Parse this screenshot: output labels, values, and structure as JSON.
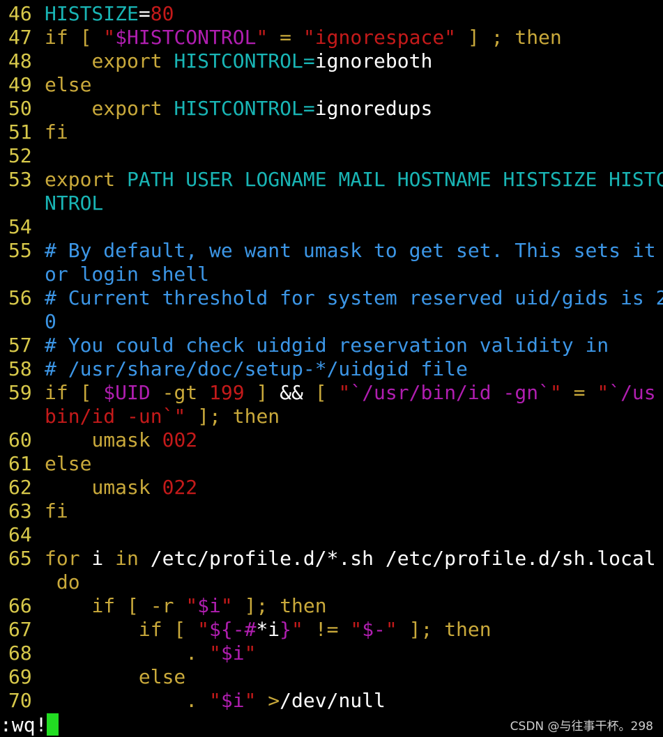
{
  "editor": {
    "rows": [
      {
        "num": "46",
        "segs": [
          [
            "HISTSIZE",
            "var"
          ],
          [
            "=",
            "txt"
          ],
          [
            "80",
            "str"
          ]
        ]
      },
      {
        "num": "47",
        "segs": [
          [
            "if",
            "kw"
          ],
          [
            " [ ",
            "op"
          ],
          [
            "\"",
            "str"
          ],
          [
            "$HISTCONTROL",
            "env"
          ],
          [
            "\"",
            "str"
          ],
          [
            " = ",
            "op"
          ],
          [
            "\"ignorespace\"",
            "str"
          ],
          [
            " ] ; ",
            "op"
          ],
          [
            "then",
            "kw"
          ]
        ]
      },
      {
        "num": "48",
        "segs": [
          [
            "    ",
            "txt"
          ],
          [
            "export",
            "kw"
          ],
          [
            " ",
            "txt"
          ],
          [
            "HISTCONTROL=",
            "var"
          ],
          [
            "ignoreboth",
            "txt"
          ]
        ]
      },
      {
        "num": "49",
        "segs": [
          [
            "else",
            "kw"
          ]
        ]
      },
      {
        "num": "50",
        "segs": [
          [
            "    ",
            "txt"
          ],
          [
            "export",
            "kw"
          ],
          [
            " ",
            "txt"
          ],
          [
            "HISTCONTROL=",
            "var"
          ],
          [
            "ignoredups",
            "txt"
          ]
        ]
      },
      {
        "num": "51",
        "segs": [
          [
            "fi",
            "kw"
          ]
        ]
      },
      {
        "num": "52",
        "segs": []
      },
      {
        "num": "53",
        "segs": [
          [
            "export",
            "kw"
          ],
          [
            " PATH USER LOGNAME MAIL HOSTNAME HISTSIZE HISTC",
            "var"
          ]
        ]
      },
      {
        "num": "",
        "segs": [
          [
            "NTROL",
            "var"
          ]
        ]
      },
      {
        "num": "54",
        "segs": []
      },
      {
        "num": "55",
        "segs": [
          [
            "# By default, we want umask to get set. This sets it",
            "cmt"
          ]
        ]
      },
      {
        "num": "",
        "segs": [
          [
            "or login shell",
            "cmt"
          ]
        ]
      },
      {
        "num": "56",
        "segs": [
          [
            "# Current threshold for system reserved uid/gids is 2",
            "cmt"
          ]
        ]
      },
      {
        "num": "",
        "segs": [
          [
            "0",
            "cmt"
          ]
        ]
      },
      {
        "num": "57",
        "segs": [
          [
            "# You could check uidgid reservation validity in",
            "cmt"
          ]
        ]
      },
      {
        "num": "58",
        "segs": [
          [
            "# /usr/share/doc/setup-*/uidgid file",
            "cmt"
          ]
        ]
      },
      {
        "num": "59",
        "segs": [
          [
            "if",
            "kw"
          ],
          [
            " [ ",
            "op"
          ],
          [
            "$UID",
            "env"
          ],
          [
            " -gt ",
            "op"
          ],
          [
            "199",
            "str"
          ],
          [
            " ] ",
            "op"
          ],
          [
            "&&",
            "txt"
          ],
          [
            " [ ",
            "op"
          ],
          [
            "\"",
            "str"
          ],
          [
            "`/usr/bin/id -gn`",
            "env"
          ],
          [
            "\"",
            "str"
          ],
          [
            " = ",
            "op"
          ],
          [
            "\"",
            "str"
          ],
          [
            "`/us",
            "env"
          ]
        ]
      },
      {
        "num": "",
        "segs": [
          [
            "bin/id -un`",
            "str"
          ],
          [
            "\"",
            "str"
          ],
          [
            " ]; ",
            "op"
          ],
          [
            "then",
            "kw"
          ]
        ]
      },
      {
        "num": "60",
        "segs": [
          [
            "    ",
            "txt"
          ],
          [
            "umask",
            "kw"
          ],
          [
            " ",
            "txt"
          ],
          [
            "002",
            "str"
          ]
        ]
      },
      {
        "num": "61",
        "segs": [
          [
            "else",
            "kw"
          ]
        ]
      },
      {
        "num": "62",
        "segs": [
          [
            "    ",
            "txt"
          ],
          [
            "umask",
            "kw"
          ],
          [
            " ",
            "txt"
          ],
          [
            "022",
            "str"
          ]
        ]
      },
      {
        "num": "63",
        "segs": [
          [
            "fi",
            "kw"
          ]
        ]
      },
      {
        "num": "64",
        "segs": []
      },
      {
        "num": "65",
        "segs": [
          [
            "for",
            "kw"
          ],
          [
            " i ",
            "txt"
          ],
          [
            "in",
            "kw"
          ],
          [
            " /etc/profile.d/*.sh /etc/profile.d/sh.local",
            "txt"
          ]
        ]
      },
      {
        "num": "",
        "segs": [
          [
            " ",
            "txt"
          ],
          [
            "do",
            "kw"
          ]
        ]
      },
      {
        "num": "66",
        "segs": [
          [
            "    ",
            "txt"
          ],
          [
            "if",
            "kw"
          ],
          [
            " [ ",
            "op"
          ],
          [
            "-r ",
            "op"
          ],
          [
            "\"",
            "str"
          ],
          [
            "$i",
            "env"
          ],
          [
            "\"",
            "str"
          ],
          [
            " ]; ",
            "op"
          ],
          [
            "then",
            "kw"
          ]
        ]
      },
      {
        "num": "67",
        "segs": [
          [
            "        ",
            "txt"
          ],
          [
            "if",
            "kw"
          ],
          [
            " [ ",
            "op"
          ],
          [
            "\"",
            "str"
          ],
          [
            "${-#",
            "env"
          ],
          [
            "*i",
            "txt"
          ],
          [
            "}",
            "env"
          ],
          [
            "\"",
            "str"
          ],
          [
            " != ",
            "op"
          ],
          [
            "\"",
            "str"
          ],
          [
            "$-",
            "env"
          ],
          [
            "\"",
            "str"
          ],
          [
            " ]; ",
            "op"
          ],
          [
            "then",
            "kw"
          ]
        ]
      },
      {
        "num": "68",
        "segs": [
          [
            "            ",
            "txt"
          ],
          [
            ". ",
            "kw"
          ],
          [
            "\"",
            "str"
          ],
          [
            "$i",
            "env"
          ],
          [
            "\"",
            "str"
          ]
        ]
      },
      {
        "num": "69",
        "segs": [
          [
            "        ",
            "txt"
          ],
          [
            "else",
            "kw"
          ]
        ]
      },
      {
        "num": "70",
        "segs": [
          [
            "            ",
            "txt"
          ],
          [
            ". ",
            "kw"
          ],
          [
            "\"",
            "str"
          ],
          [
            "$i",
            "env"
          ],
          [
            "\"",
            "str"
          ],
          [
            " >",
            "op"
          ],
          [
            "/dev/null",
            "txt"
          ]
        ]
      }
    ]
  },
  "statusline": {
    "command": ":wq!"
  },
  "watermark": {
    "text": "CSDN @与往事干杯。298"
  },
  "colors": {
    "background": "#000000",
    "line_number": "#d7c84a",
    "keyword": "#c9a93b",
    "variable": "#19b5b5",
    "string": "#c41a1a",
    "special": "#b01eb0",
    "comment": "#3c96e6",
    "text": "#ffffff",
    "cursor": "#22dd22"
  }
}
